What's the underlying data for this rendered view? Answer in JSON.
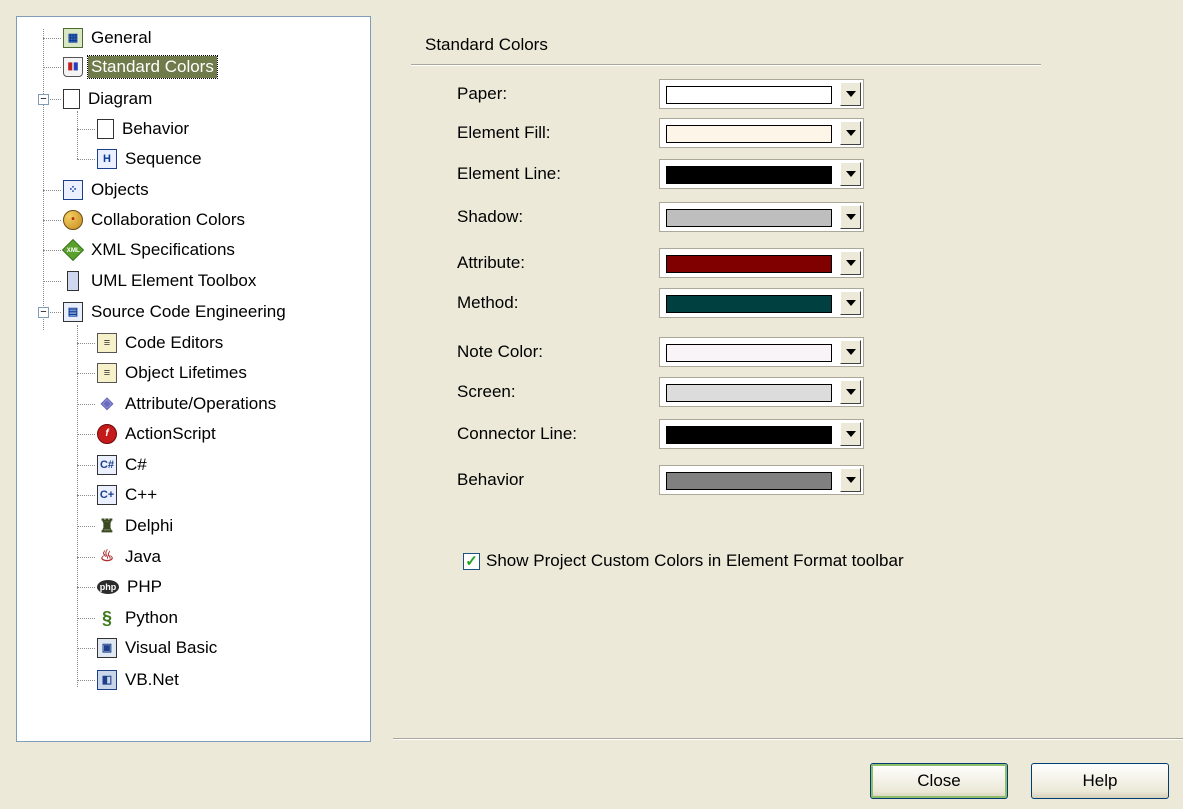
{
  "tree": {
    "items": [
      {
        "label": "General",
        "icon": "general-icon"
      },
      {
        "label": "Standard Colors",
        "icon": "paint-pot-icon",
        "selected": true
      },
      {
        "label": "Diagram",
        "icon": "page-icon",
        "expanded": true
      },
      {
        "label": "Behavior",
        "icon": "page-icon"
      },
      {
        "label": "Sequence",
        "icon": "sequence-icon"
      },
      {
        "label": "Objects",
        "icon": "objects-icon"
      },
      {
        "label": "Collaboration Colors",
        "icon": "palette-icon"
      },
      {
        "label": "XML Specifications",
        "icon": "xml-icon"
      },
      {
        "label": "UML Element Toolbox",
        "icon": "toolbox-icon"
      },
      {
        "label": "Source Code Engineering",
        "icon": "windows-icon",
        "expanded": true
      },
      {
        "label": "Code Editors",
        "icon": "code-editor-icon"
      },
      {
        "label": "Object Lifetimes",
        "icon": "code-editor-icon"
      },
      {
        "label": "Attribute/Operations",
        "icon": "attribute-icon"
      },
      {
        "label": "ActionScript",
        "icon": "actionscript-icon"
      },
      {
        "label": "C#",
        "icon": "csharp-icon"
      },
      {
        "label": "C++",
        "icon": "cpp-icon"
      },
      {
        "label": "Delphi",
        "icon": "delphi-icon"
      },
      {
        "label": "Java",
        "icon": "java-icon"
      },
      {
        "label": "PHP",
        "icon": "php-icon"
      },
      {
        "label": "Python",
        "icon": "python-icon"
      },
      {
        "label": "Visual Basic",
        "icon": "visual-basic-icon"
      },
      {
        "label": "VB.Net",
        "icon": "vbnet-icon"
      }
    ],
    "icon_text": {
      "xml": "XML",
      "csharp": "C#",
      "cpp": "C+",
      "php": "php",
      "sequence": "H"
    }
  },
  "section": {
    "title": "Standard Colors"
  },
  "colors": [
    {
      "label": "Paper:",
      "color": "#FFFFFF"
    },
    {
      "label": "Element Fill:",
      "color": "#FDF5E8"
    },
    {
      "label": "Element Line:",
      "color": "#000000"
    },
    {
      "label": "Shadow:",
      "color": "#BEBEBE"
    },
    {
      "label": "Attribute:",
      "color": "#800000"
    },
    {
      "label": "Method:",
      "color": "#004040"
    },
    {
      "label": "Note Color:",
      "color": "#F8F4F8"
    },
    {
      "label": "Screen:",
      "color": "#DCDCDC"
    },
    {
      "label": "Connector Line:",
      "color": "#000000"
    },
    {
      "label": "Behavior",
      "color": "#808080"
    }
  ],
  "checkbox": {
    "label": "Show Project Custom Colors in Element Format toolbar",
    "checked": true
  },
  "buttons": {
    "close": "Close",
    "help": "Help"
  },
  "theme": {
    "selection": "#6F7B4A",
    "check": "#21A121"
  }
}
